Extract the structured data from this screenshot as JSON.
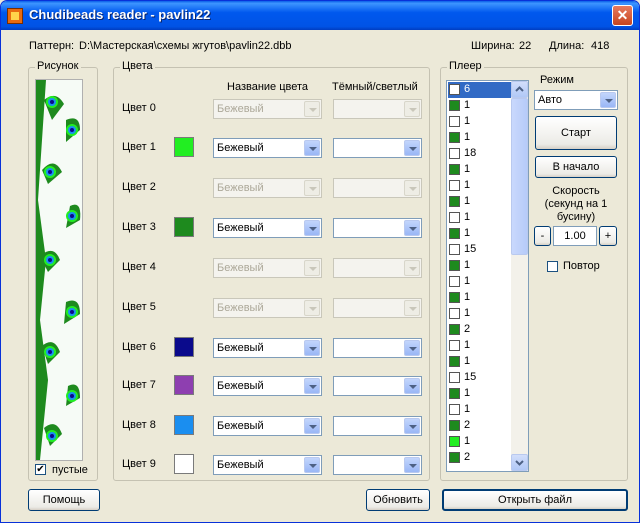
{
  "window": {
    "title": "Chudibeads reader - pavlin22",
    "close_glyph": "✕"
  },
  "info": {
    "pattern_label": "Паттерн:",
    "pattern_path": "D:\\Мастерская\\схемы жгутов\\pavlin22.dbb",
    "width_label": "Ширина:",
    "width_value": "22",
    "length_label": "Длина:",
    "length_value": "418"
  },
  "preview": {
    "title": "Рисунок",
    "empty_label": "пустые",
    "empty_checked": "✔"
  },
  "colors": {
    "title": "Цвета",
    "col_name": "Название цвета",
    "col_shade": "Тёмный/светлый",
    "rows": [
      {
        "label": "Цвет 0",
        "swatch": "",
        "name": "Бежевый",
        "enabled": false
      },
      {
        "label": "Цвет 1",
        "swatch": "#22ee22",
        "name": "Бежевый",
        "enabled": true
      },
      {
        "label": "Цвет 2",
        "swatch": "",
        "name": "Бежевый",
        "enabled": false
      },
      {
        "label": "Цвет 3",
        "swatch": "#1e8a1e",
        "name": "Бежевый",
        "enabled": true
      },
      {
        "label": "Цвет 4",
        "swatch": "",
        "name": "Бежевый",
        "enabled": false
      },
      {
        "label": "Цвет 5",
        "swatch": "",
        "name": "Бежевый",
        "enabled": false
      },
      {
        "label": "Цвет 6",
        "swatch": "#0a0a8c",
        "name": "Бежевый",
        "enabled": true
      },
      {
        "label": "Цвет 7",
        "swatch": "#8e3fb0",
        "name": "Бежевый",
        "enabled": true
      },
      {
        "label": "Цвет 8",
        "swatch": "#1a8ef0",
        "name": "Бежевый",
        "enabled": true
      },
      {
        "label": "Цвет 9",
        "swatch": "#ffffff",
        "name": "Бежевый",
        "enabled": true
      }
    ]
  },
  "player": {
    "title": "Плеер",
    "mode_label": "Режим",
    "mode_value": "Авто",
    "start_label": "Старт",
    "reset_label": "В начало",
    "speed_label_1": "Скорость",
    "speed_label_2": "(секунд на 1",
    "speed_label_3": "бусину)",
    "speed_minus": "-",
    "speed_value": "1.00",
    "speed_plus": "+",
    "repeat_label": "Повтор",
    "items": [
      {
        "color": "#ffffff",
        "count": "6",
        "selected": true
      },
      {
        "color": "#1e8a1e",
        "count": "1"
      },
      {
        "color": "#ffffff",
        "count": "1"
      },
      {
        "color": "#1e8a1e",
        "count": "1"
      },
      {
        "color": "#ffffff",
        "count": "18"
      },
      {
        "color": "#1e8a1e",
        "count": "1"
      },
      {
        "color": "#ffffff",
        "count": "1"
      },
      {
        "color": "#1e8a1e",
        "count": "1"
      },
      {
        "color": "#ffffff",
        "count": "1"
      },
      {
        "color": "#1e8a1e",
        "count": "1"
      },
      {
        "color": "#ffffff",
        "count": "15"
      },
      {
        "color": "#1e8a1e",
        "count": "1"
      },
      {
        "color": "#ffffff",
        "count": "1"
      },
      {
        "color": "#1e8a1e",
        "count": "1"
      },
      {
        "color": "#ffffff",
        "count": "1"
      },
      {
        "color": "#1e8a1e",
        "count": "2"
      },
      {
        "color": "#ffffff",
        "count": "1"
      },
      {
        "color": "#1e8a1e",
        "count": "1"
      },
      {
        "color": "#ffffff",
        "count": "15"
      },
      {
        "color": "#1e8a1e",
        "count": "1"
      },
      {
        "color": "#ffffff",
        "count": "1"
      },
      {
        "color": "#1e8a1e",
        "count": "2"
      },
      {
        "color": "#22ee22",
        "count": "1"
      },
      {
        "color": "#1e8a1e",
        "count": "2"
      }
    ]
  },
  "footer": {
    "help": "Помощь",
    "refresh": "Обновить",
    "open": "Открыть файл"
  }
}
